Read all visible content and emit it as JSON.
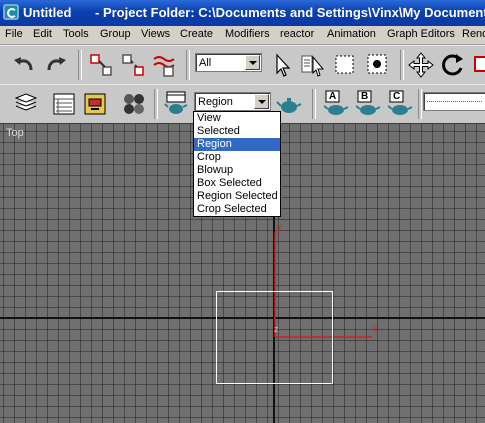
{
  "window": {
    "title_app": "Untitled",
    "title_project": "- Project Folder: C:\\Documents and Settings\\Vinx\\My Document"
  },
  "menu": [
    "File",
    "Edit",
    "Tools",
    "Group",
    "Views",
    "Create",
    "Modifiers",
    "reactor",
    "Animation",
    "Graph Editors",
    "Rend"
  ],
  "toolbar1": {
    "selection_filter": "All"
  },
  "toolbar2": {
    "render_type": "Region",
    "render_type_options": [
      "View",
      "Selected",
      "Region",
      "Crop",
      "Blowup",
      "Box Selected",
      "Region Selected",
      "Crop Selected"
    ],
    "selected_index": 2,
    "preset_buttons": [
      "A",
      "B",
      "C"
    ]
  },
  "viewport": {
    "label": "Top",
    "axis_x": "x",
    "axis_y": "y",
    "origin_z": "z"
  },
  "colors": {
    "titlebar": "#0a3fae",
    "highlight": "#316ac5",
    "viewport_bg": "#6f6f6f",
    "axis_x": "#d02020",
    "axis_y": "#d02020"
  }
}
